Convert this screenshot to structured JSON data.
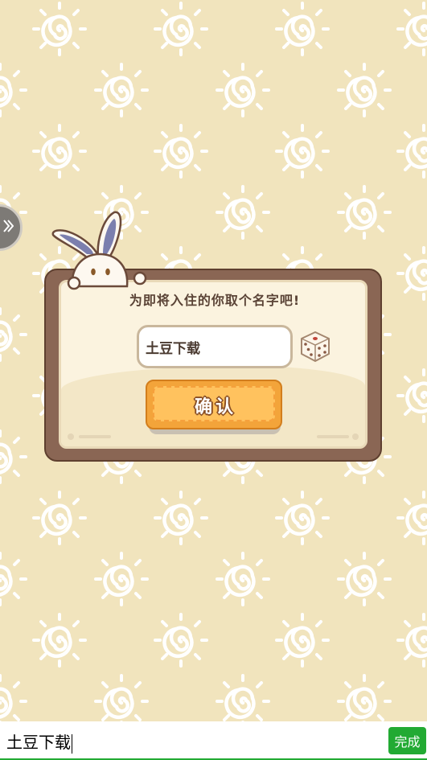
{
  "dialog": {
    "title": "为即将入住的你取个名字吧!",
    "name_value": "土豆下载",
    "confirm_label": "确认"
  },
  "keyboard": {
    "input_text": "土豆下载",
    "done_label": "完成"
  },
  "icons": {
    "side_handle": "double-chevron-right-icon",
    "dice": "dice-icon",
    "mascot": "rabbit-mascot",
    "background": "sun-swirl-pattern"
  },
  "colors": {
    "background": "#f1e4bd",
    "pattern": "#ffffff",
    "dialog_frame": "#8a6654",
    "dialog_panel": "#fbf3df",
    "button": "#f3a43a",
    "keyboard_accent": "#22aa33"
  }
}
